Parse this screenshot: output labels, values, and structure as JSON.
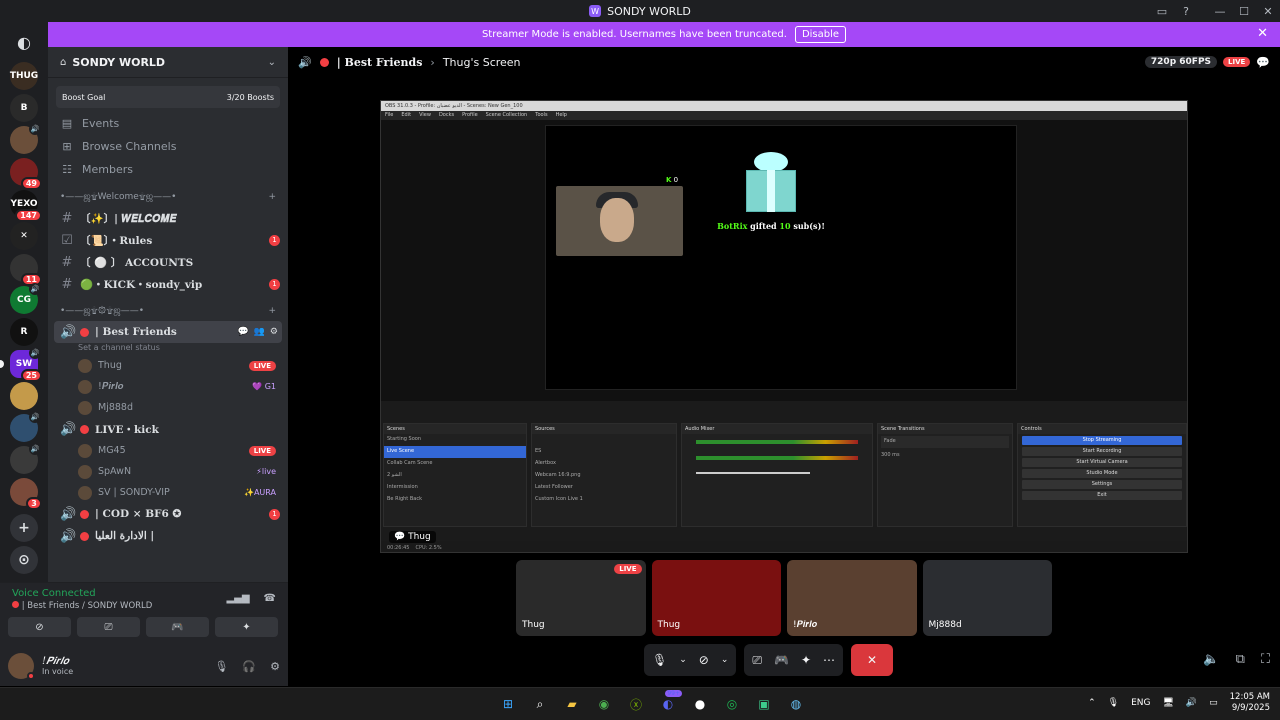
{
  "window": {
    "title": "SONDY WORLD",
    "controls": [
      "▭",
      "?",
      "—",
      "☐",
      "✕"
    ]
  },
  "servers": [
    {
      "label": "THUG",
      "color": "#3a2d22"
    },
    {
      "label": "B",
      "color": "#2a2a2a"
    },
    {
      "label": "",
      "color": "#6b4f3a",
      "speaker": true
    },
    {
      "label": "",
      "color": "#7a2020",
      "badge": "49"
    },
    {
      "label": "YEXO",
      "color": "#111111",
      "badge": "147"
    },
    {
      "label": "✕",
      "color": "#222222"
    },
    {
      "label": "",
      "color": "#333333",
      "badge": "11"
    },
    {
      "label": "CG",
      "color": "#0f7a32",
      "speaker": true
    },
    {
      "label": "R",
      "color": "#111111"
    },
    {
      "label": "SW",
      "color": "#6d28d9",
      "badge": "25",
      "speaker": true,
      "active": true
    },
    {
      "label": "",
      "color": "#c49a4a"
    },
    {
      "label": "",
      "color": "#2f4f6f",
      "speaker": true
    },
    {
      "label": "",
      "color": "#3a3a3a",
      "speaker": true
    },
    {
      "label": "",
      "color": "#7a4a3a",
      "badge": "3"
    }
  ],
  "banner": {
    "message": "Streamer Mode is enabled. Usernames have been truncated.",
    "disable_label": "Disable"
  },
  "server": {
    "name": "SONDY WORLD",
    "boost_goal": "Boost Goal",
    "boost_count": "3/20 Boosts"
  },
  "nav": [
    {
      "icon": "▤",
      "label": "Events"
    },
    {
      "icon": "⊞",
      "label": "Browse Channels"
    },
    {
      "icon": "☷",
      "label": "Members"
    }
  ],
  "categories": [
    {
      "label": "•——ஜ۩Welcome۩ஜ——•",
      "channels": [
        {
          "icon": "#",
          "name": "〔✨〕| 𝑾𝑬𝑳𝑪𝑶𝑴𝑬",
          "count": ""
        },
        {
          "icon": "☑",
          "name": "〔📜〕・Rules",
          "count": "1"
        },
        {
          "icon": "#",
          "name": "〔 ⚪ 〕 ACCOUNTS",
          "count": ""
        },
        {
          "icon": "#",
          "name": "🟢・KICK・sondy_vip",
          "count": "1"
        }
      ]
    },
    {
      "label": "•——ஜ۩۞۩ஜ——•"
    }
  ],
  "voice_channels": [
    {
      "name": "| Best Friends",
      "active": true,
      "status": "Set a channel status",
      "users": [
        {
          "name": "Thug",
          "tag": "LIVE"
        },
        {
          "name": "!𝑷𝒊𝒓𝒍𝒐",
          "tag": "💜 G1"
        },
        {
          "name": "Mj888d",
          "tag": ""
        }
      ]
    },
    {
      "name": "LIVE・kick",
      "users": [
        {
          "name": "MG45",
          "tag": "LIVE"
        },
        {
          "name": "SpAwN",
          "tag": "⚡live"
        },
        {
          "name": "SV | SONDY-VIP",
          "tag": "✨AURA"
        }
      ]
    },
    {
      "name": "| COD × BF6 ✪",
      "count": "1"
    },
    {
      "name": "الادارة العليا |",
      "users": []
    }
  ],
  "voice": {
    "connected": "Voice Connected",
    "channel": "| Best Friends / SONDY WORLD"
  },
  "user": {
    "name": "!𝑷𝒊𝒓𝒍𝒐",
    "status": "In voice"
  },
  "stage": {
    "channel": "| Best Friends",
    "screen_label": "Thug's Screen",
    "quality": "720p 60FPS",
    "live": "LIVE",
    "share_label": "Thug"
  },
  "obs": {
    "title": "OBS 31.0.3 - Profile: الديو عضبان - Scenes: New Gen_100",
    "menu": [
      "File",
      "Edit",
      "View",
      "Docks",
      "Profile",
      "Scene Collection",
      "Tools",
      "Help"
    ],
    "kick_count": "0",
    "gift_user": "BotRix",
    "gift_text": "gifted",
    "gift_num": "10",
    "gift_suffix": "sub(s)!",
    "scenes_title": "Scenes",
    "scenes": [
      "Starting Soon",
      "Live Scene",
      "Collab Cam Scene",
      "الشو 2",
      "Intermission",
      "Be Right Back"
    ],
    "sources_title": "Sources",
    "sources": [
      "",
      "ES",
      "Alertbox",
      "Webcam 16:9.png",
      "Latest Follower",
      "Custom Icon Live 1"
    ],
    "mixer_title": "Audio Mixer",
    "transitions_title": "Scene Transitions",
    "transition": "Fade",
    "duration": "300 ms",
    "controls_title": "Controls",
    "controls": [
      "Stop Streaming",
      "Start Recording",
      "Start Virtual Camera",
      "Studio Mode",
      "Settings",
      "Exit"
    ],
    "status": "00:26:45",
    "cpu": "CPU: 2.5%"
  },
  "tiles": [
    {
      "name": "Thug",
      "live": "LIVE",
      "color": "#2a2a2a"
    },
    {
      "name": "Thug",
      "live": "",
      "color": "#7a1010"
    },
    {
      "name": "!𝑷𝒊𝒓𝒍𝒐",
      "live": "",
      "color": "#5a4030"
    },
    {
      "name": "Mj888d",
      "live": "",
      "color": "#2b2d31"
    }
  ],
  "taskbar": {
    "lang": "ENG",
    "time": "12:05 AM",
    "date": "9/9/2025"
  }
}
